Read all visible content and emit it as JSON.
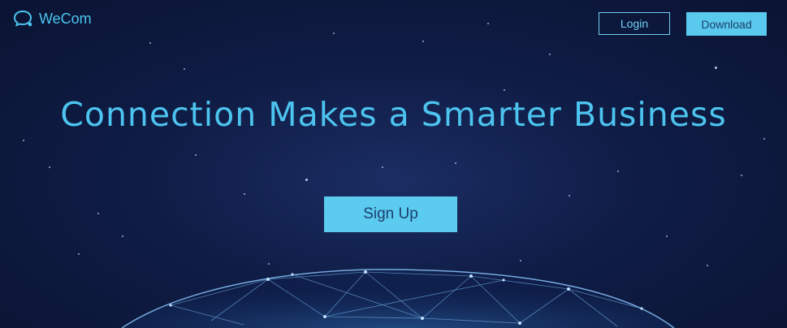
{
  "header": {
    "logo_text": "WeCom",
    "login_label": "Login",
    "download_label": "Download"
  },
  "hero": {
    "headline": "Connection Makes a Smarter Business",
    "signup_label": "Sign Up"
  },
  "colors": {
    "accent": "#4cc4ef",
    "button_fill": "#5ccbf0",
    "background": "#0f1c45"
  }
}
